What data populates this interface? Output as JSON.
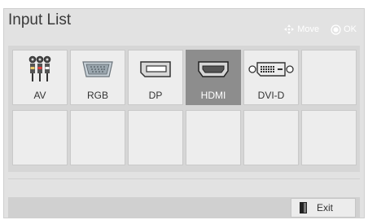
{
  "window": {
    "title": "Input List"
  },
  "hints": {
    "move_label": "Move",
    "ok_label": "OK",
    "move_icon": "move-arrows-icon",
    "ok_icon": "ok-circle-icon"
  },
  "inputs": [
    {
      "label": "AV",
      "icon": "av-rca-icon",
      "selected": false
    },
    {
      "label": "RGB",
      "icon": "rgb-vga-icon",
      "selected": false
    },
    {
      "label": "DP",
      "icon": "displayport-icon",
      "selected": false
    },
    {
      "label": "HDMI",
      "icon": "hdmi-icon",
      "selected": true
    },
    {
      "label": "DVI-D",
      "icon": "dvi-d-icon",
      "selected": false
    },
    {
      "label": "",
      "icon": "",
      "selected": false
    },
    {
      "label": "",
      "icon": "",
      "selected": false
    },
    {
      "label": "",
      "icon": "",
      "selected": false
    },
    {
      "label": "",
      "icon": "",
      "selected": false
    },
    {
      "label": "",
      "icon": "",
      "selected": false
    },
    {
      "label": "",
      "icon": "",
      "selected": false
    },
    {
      "label": "",
      "icon": "",
      "selected": false
    }
  ],
  "footer": {
    "exit_label": "Exit",
    "exit_icon": "exit-door-icon"
  },
  "colors": {
    "panel_bg": "#e2e2e2",
    "cell_bg": "#ededed",
    "selected_bg": "#8d8d8d",
    "text": "#333333"
  }
}
